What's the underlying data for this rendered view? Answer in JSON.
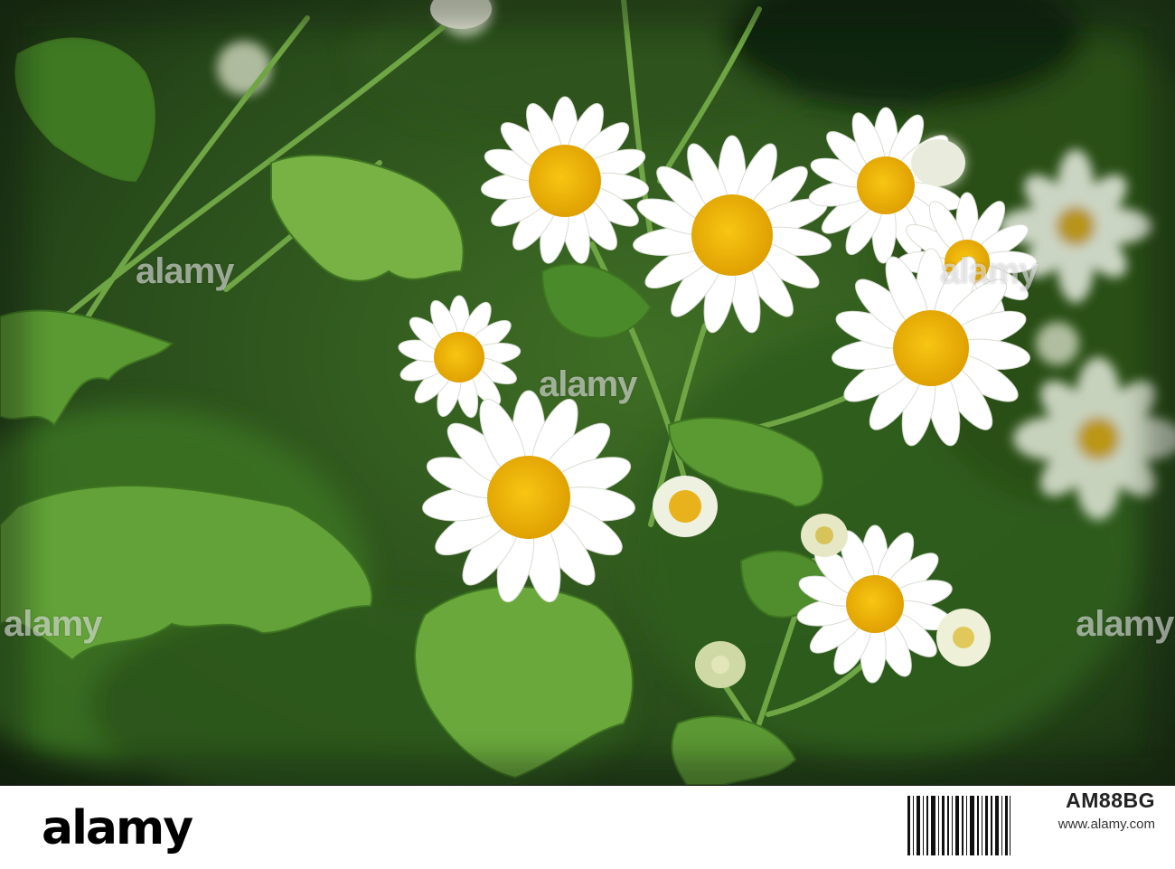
{
  "photo": {
    "subject": "feverfew daisy flowers",
    "colors": {
      "foliage": "#4e8a2e",
      "petal": "#ffffff",
      "disc": "#f2b600",
      "background": "#1f3a14"
    }
  },
  "watermark": {
    "text": "alamy"
  },
  "footer": {
    "brand": "alamy",
    "image_id": "AM88BG",
    "url": "www.alamy.com"
  }
}
